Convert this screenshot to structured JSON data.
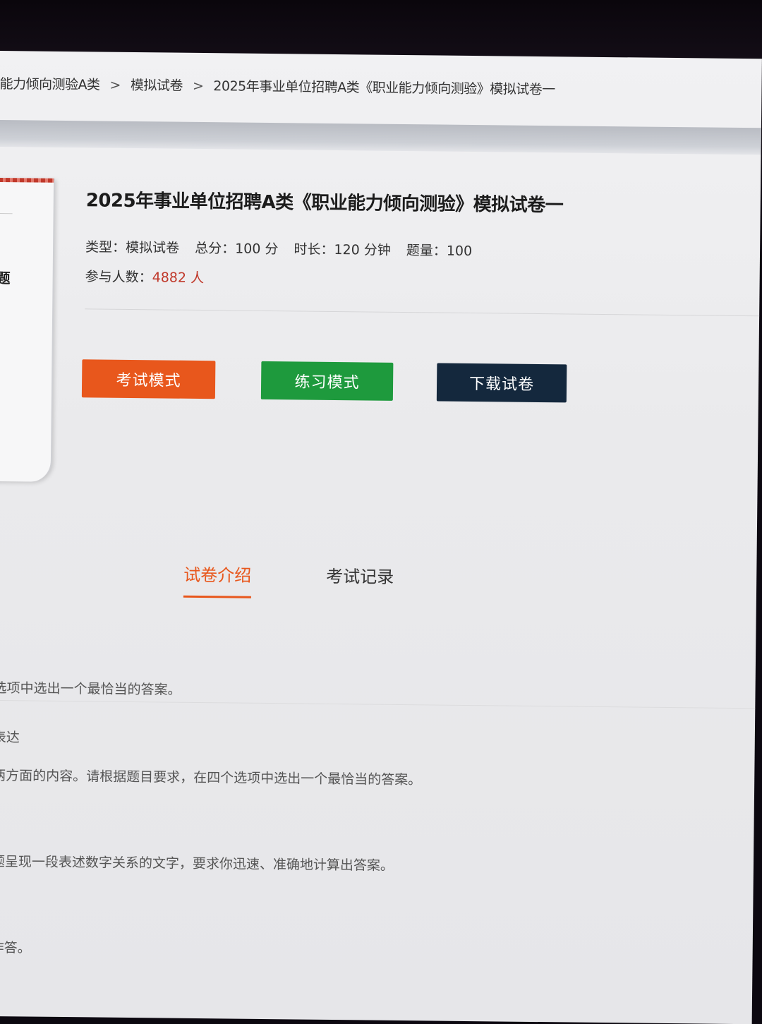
{
  "breadcrumb": {
    "items": [
      "能力倾向测验A类",
      "模拟试卷",
      "2025年事业单位招聘A类《职业能力倾向测验》模拟试卷一"
    ],
    "separator": ">"
  },
  "cover": {
    "partial_text": "题"
  },
  "paper": {
    "title": "2025年事业单位招聘A类《职业能力倾向测验》模拟试卷一",
    "type_label": "类型：模拟试卷",
    "score_label": "总分：100 分",
    "duration_label": "时长：120 分钟",
    "count_label": "题量：100",
    "participants_prefix": "参与人数：",
    "participants_value": "4882 人"
  },
  "actions": {
    "exam_mode": "考试模式",
    "practice_mode": "练习模式",
    "download": "下载试卷"
  },
  "tabs": {
    "intro": "试卷介绍",
    "records": "考试记录"
  },
  "intro_text": {
    "line1": "选项中选出一个最恰当的答案。",
    "line2": "表达",
    "line3": "两方面的内容。请根据题目要求，在四个选项中选出一个最恰当的答案。",
    "line4": "题呈现一段表述数字关系的文字，要求你迅速、准确地计算出答案。",
    "line5": "作答。"
  },
  "colors": {
    "accent_orange": "#e8571c",
    "practice_green": "#1e9a3d",
    "download_navy": "#14283d",
    "highlight_red": "#c0392b"
  }
}
